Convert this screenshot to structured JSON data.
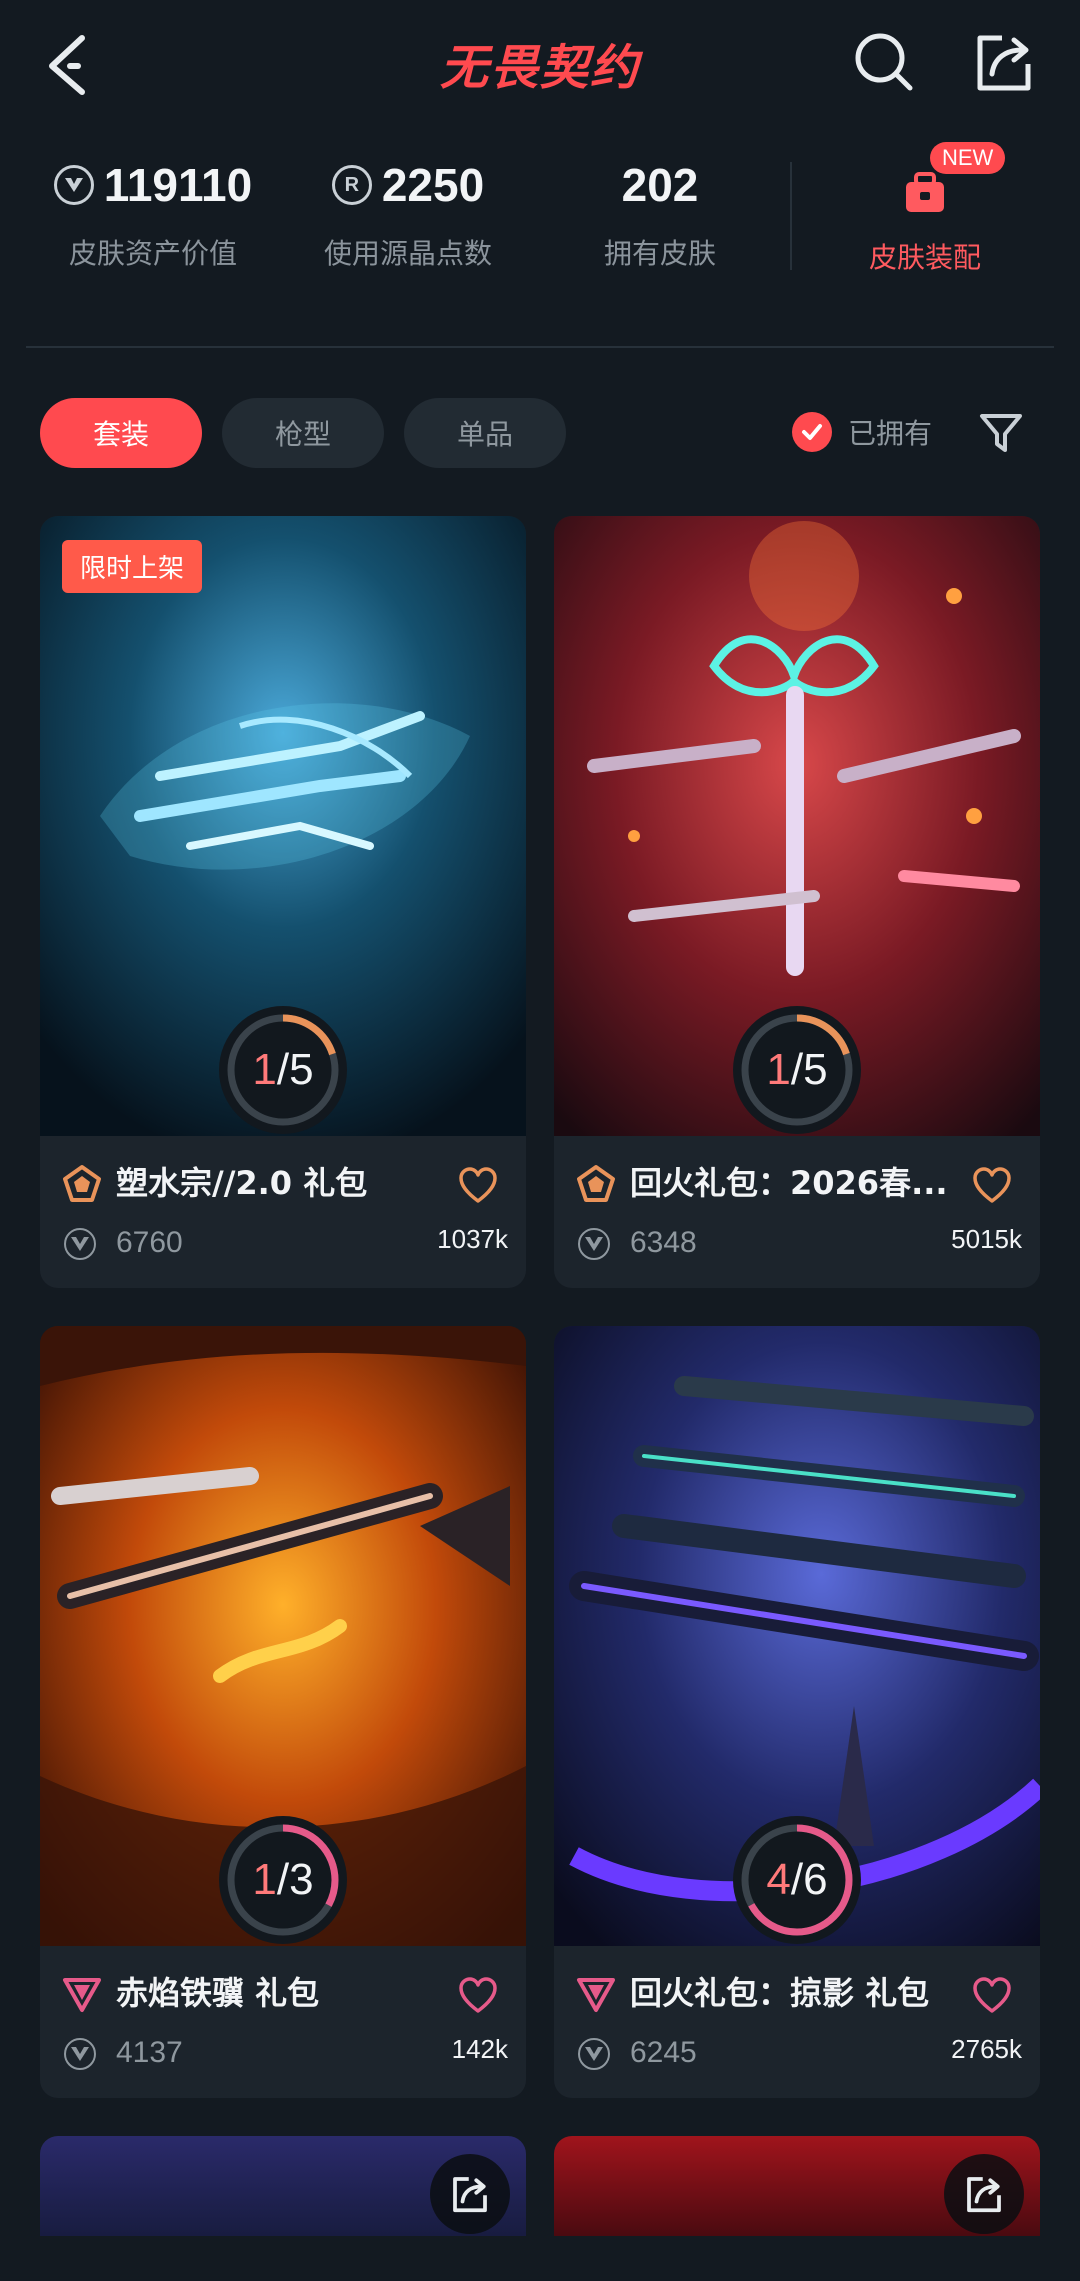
{
  "header": {
    "title": "无畏契约",
    "back_icon": "chevron-left-icon",
    "search_icon": "search-icon",
    "share_icon": "share-icon"
  },
  "stats": [
    {
      "icon": "vp-icon",
      "value": "119110",
      "label": "皮肤资产价值"
    },
    {
      "icon": "radianite-icon",
      "icon_glyph": "R",
      "value": "2250",
      "label": "使用源晶点数"
    },
    {
      "value": "202",
      "label": "拥有皮肤"
    }
  ],
  "equip": {
    "label": "皮肤装配",
    "badge": "NEW",
    "icon": "backpack-icon"
  },
  "tabs": [
    {
      "label": "套装",
      "active": true
    },
    {
      "label": "枪型",
      "active": false
    },
    {
      "label": "单品",
      "active": false
    }
  ],
  "owned_filter": {
    "label": "已拥有",
    "checked": true
  },
  "cards": [
    {
      "tag": "限时上架",
      "owned": "1",
      "total": "5",
      "progress": 0.2,
      "name": "塑水宗//2.0 礼包",
      "price": "6760",
      "likes": "1037k",
      "rarity": "premium",
      "theme": "blue"
    },
    {
      "tag": "",
      "owned": "1",
      "total": "5",
      "progress": 0.2,
      "name": "回火礼包：2026春...",
      "price": "6348",
      "likes": "5015k",
      "rarity": "premium",
      "theme": "red"
    },
    {
      "tag": "",
      "owned": "1",
      "total": "3",
      "progress": 0.33,
      "name": "赤焰铁骥 礼包",
      "price": "4137",
      "likes": "142k",
      "rarity": "exclusive",
      "theme": "orange"
    },
    {
      "tag": "",
      "owned": "4",
      "total": "6",
      "progress": 0.67,
      "name": "回火礼包：掠影 礼包",
      "price": "6245",
      "likes": "2765k",
      "rarity": "exclusive",
      "theme": "purple"
    }
  ],
  "colors": {
    "accent": "#ff4a4f",
    "background": "#131a21",
    "card": "#1c242c",
    "premium": "#e9935a",
    "exclusive": "#e65a8a"
  }
}
